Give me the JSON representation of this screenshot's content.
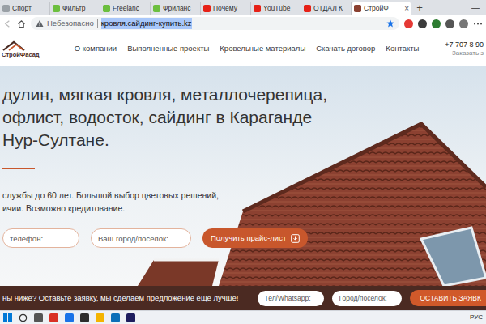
{
  "browser": {
    "tabs": [
      {
        "label": "Спорт",
        "selected": false
      },
      {
        "label": "Фильтр",
        "selected": false
      },
      {
        "label": "Freelanc",
        "selected": false
      },
      {
        "label": "Фриланс",
        "selected": false
      },
      {
        "label": "Почему",
        "selected": false
      },
      {
        "label": "YouTube",
        "selected": false
      },
      {
        "label": "ОТДАЛ К",
        "selected": false
      },
      {
        "label": "СтройФ",
        "selected": true
      }
    ],
    "close": "×",
    "new_tab": "+",
    "minimize": "—",
    "security": "Небезопасно",
    "url": "кровля.сайдинг-купить.kz",
    "url_selected": true
  },
  "site": {
    "logo": "СтройФасад",
    "nav": [
      "О компании",
      "Выполненные проекты",
      "Кровельные материалы",
      "Скачать договор",
      "Контакты"
    ],
    "phone": "+7 707 8 90",
    "order": "Заказать з"
  },
  "hero": {
    "title_lines": [
      "дулин, мягкая кровля, металлочерепица,",
      "офлист, водосток, сайдинг в Караганде",
      "Нур-Султане."
    ],
    "subtitle_lines": [
      "службы до 60 лет. Большой выбор цветовых решений,",
      "ичии. Возможно кредитование."
    ],
    "phone_placeholder": "телефон:",
    "city_placeholder": "Ваш город/поселок:",
    "button": "Получить прайс-лист"
  },
  "callback_bar": {
    "text": "ны ниже? Оставьте заявку, мы сделаем предложение еще лучше!",
    "phone_placeholder": "Тел/Whatsapp:",
    "city_placeholder": "Город/поселок:",
    "button": "ОСТАВИТЬ ЗАЯВК"
  },
  "taskbar": {
    "language": "РУС"
  }
}
